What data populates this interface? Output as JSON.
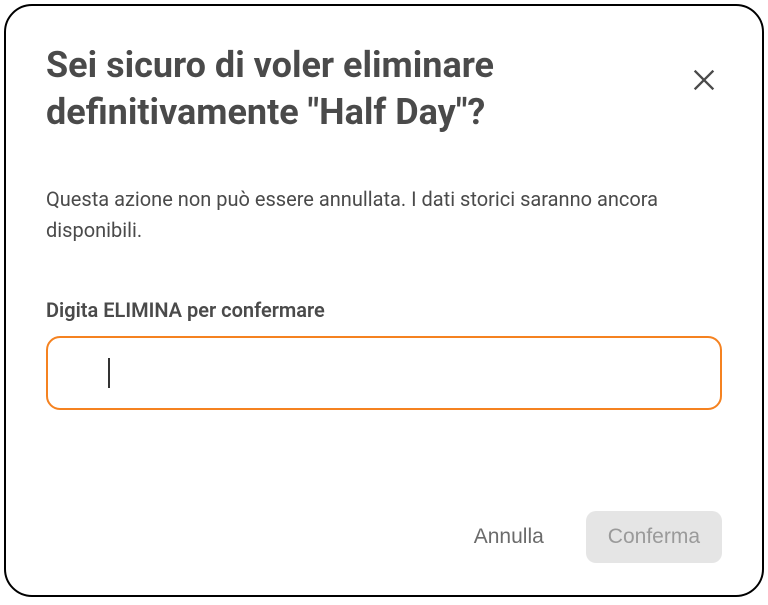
{
  "modal": {
    "title": "Sei sicuro di voler eliminare definitivamente \"Half Day\"?",
    "description": "Questa azione non può essere annullata. I dati storici saranno ancora disponibili.",
    "input_label": "Digita ELIMINA per confermare",
    "input_value": "",
    "input_placeholder": "",
    "cancel_label": "Annulla",
    "confirm_label": "Conferma"
  }
}
